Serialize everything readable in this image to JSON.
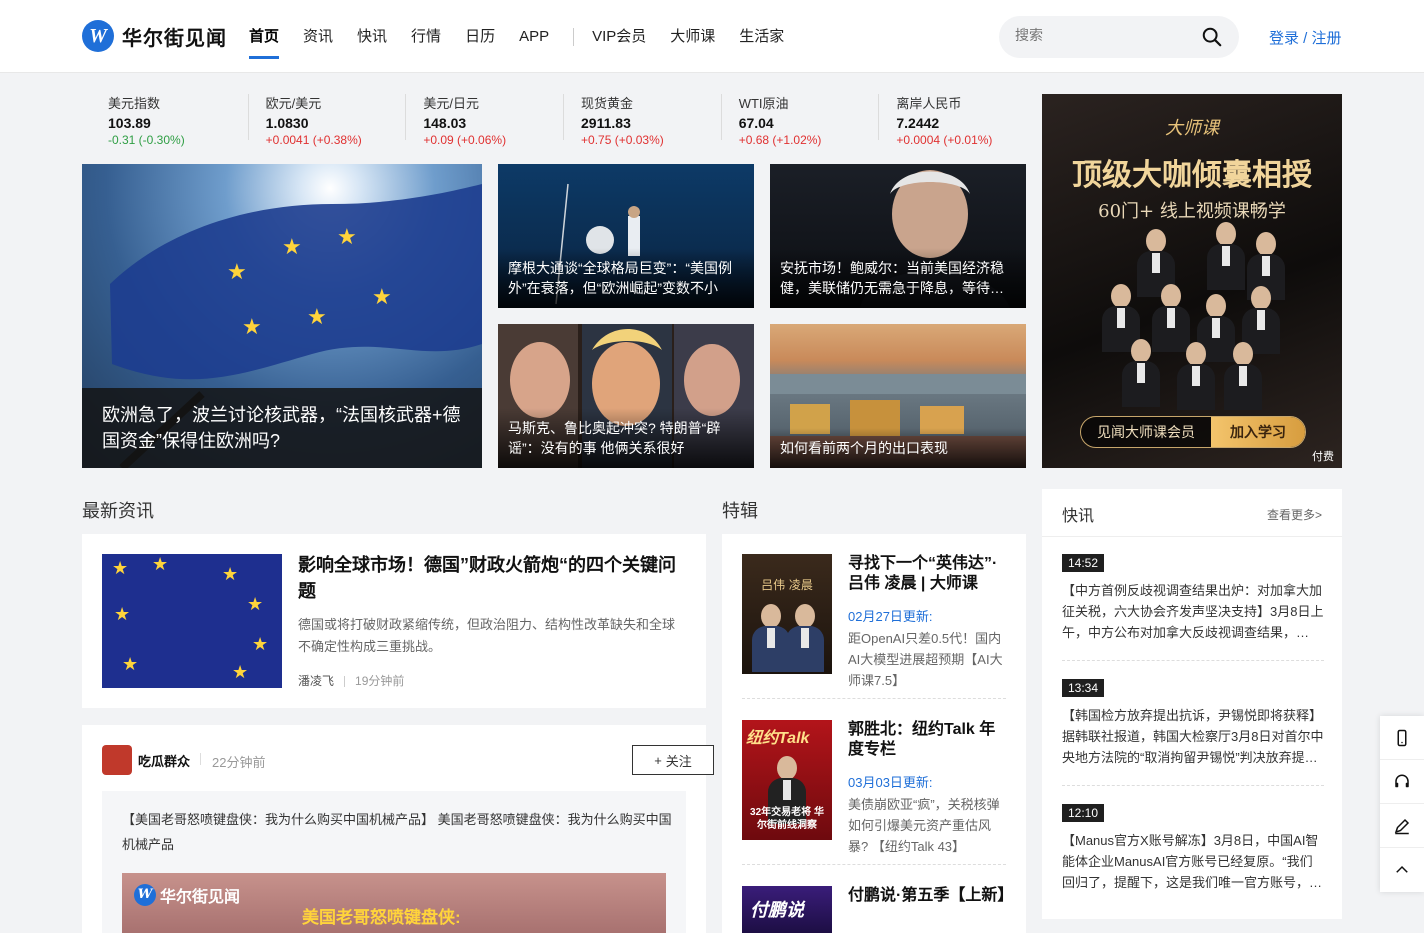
{
  "header": {
    "logo_text": "华尔街见闻",
    "nav": [
      {
        "label": "首页",
        "active": true
      },
      {
        "label": "资讯"
      },
      {
        "label": "快讯"
      },
      {
        "label": "行情"
      },
      {
        "label": "日历"
      },
      {
        "label": "APP"
      },
      {
        "label": "VIP会员"
      },
      {
        "label": "大师课"
      },
      {
        "label": "生活家"
      }
    ],
    "search_placeholder": "搜索",
    "login": "登录 / 注册"
  },
  "ticker": [
    {
      "name": "美元指数",
      "price": "103.89",
      "change": "-0.31 (-0.30%)",
      "dir": "down"
    },
    {
      "name": "欧元/美元",
      "price": "1.0830",
      "change": "+0.0041 (+0.38%)",
      "dir": "up"
    },
    {
      "name": "美元/日元",
      "price": "148.03",
      "change": "+0.09 (+0.06%)",
      "dir": "up"
    },
    {
      "name": "现货黄金",
      "price": "2911.83",
      "change": "+0.75 (+0.03%)",
      "dir": "up"
    },
    {
      "name": "WTI原油",
      "price": "67.04",
      "change": "+0.68 (+1.02%)",
      "dir": "up"
    },
    {
      "name": "离岸人民币",
      "price": "7.2442",
      "change": "+0.0004 (+0.01%)",
      "dir": "up"
    }
  ],
  "hero": {
    "main": "欧洲急了，波兰讨论核武器，“法国核武器+德国资金”保得住欧洲吗?",
    "tiles": [
      "摩根大通谈“全球格局巨变”：“美国例外”在衰落，但“欧洲崛起”变数不小",
      "安抚市场！鲍威尔：当前美国经济稳健，美联储仍无需急于降息，等待…",
      "马斯克、鲁比奥起冲突? 特朗普“辟谣”：没有的事 他俩关系很好",
      "如何看前两个月的出口表现"
    ]
  },
  "ad": {
    "brand": "大师课",
    "title": "顶级大咖倾囊相授",
    "subtitle": "60门+ 线上视频课畅学",
    "button_left": "见闻大师课会员",
    "button_right": "加入学习",
    "paid": "付费"
  },
  "latest": {
    "title": "最新资讯",
    "article": {
      "title": "影响全球市场！德国”财政火箭炮“的四个关键问题",
      "summary": "德国或将打破财政紧缩传统，但政治阻力、结构性改革缺失和全球不确定性构成三重挑战。",
      "author": "潘凌飞",
      "time": "19分钟前"
    },
    "post": {
      "user": "吃瓜群众",
      "time": "22分钟前",
      "follow": "关注",
      "text": "【美国老哥怒喷键盘侠：我为什么购买中国机械产品】 美国老哥怒喷键盘侠：我为什么购买中国机械产品",
      "video_logo": "华尔街见闻",
      "video_caption": "美国老哥怒喷键盘侠:"
    }
  },
  "special": {
    "title": "特辑",
    "items": [
      {
        "title": "寻找下一个“英伟达”· 吕伟 凌晨 | 大师课",
        "date": "02月27日更新:",
        "desc": "距OpenAI只差0.5代！国内AI大模型进展超预期【AI大师课7.5】",
        "cover_label": "吕伟 凌晨"
      },
      {
        "title": "郭胜北：纽约Talk 年度专栏",
        "date": "03月03日更新:",
        "desc": "美债崩欧亚“疯”，关税核弹如何引爆美元资产重估风暴? 【纽约Talk 43】",
        "cover_label": "纽约Talk",
        "cover_sub": "32年交易老将 华尔街前线洞察"
      },
      {
        "title": "付鹏说·第五季【上新】",
        "cover_label": "付鹏说"
      }
    ]
  },
  "flash": {
    "title": "快讯",
    "more": "查看更多>",
    "items": [
      {
        "time": "14:52",
        "text": "【中方首例反歧视调查结果出炉：对加拿大加征关税，六大协会齐发声坚决支持】3月8日上午，中方公布对加拿大反歧视调查结果，…"
      },
      {
        "time": "13:34",
        "text": "【韩国检方放弃提出抗诉，尹锡悦即将获释】据韩联社报道，韩国大检察厅3月8日对首尔中央地方法院的“取消拘留尹锡悦”判决放弃提…"
      },
      {
        "time": "12:10",
        "text": "【Manus官方X账号解冻】3月8日，中国AI智能体企业ManusAI官方账号已经复原。“我们回归了，提醒下，这是我们唯一官方账号，…"
      }
    ]
  },
  "colors": {
    "accent": "#1f6fd8",
    "up": "#e03131",
    "down": "#2f9e44"
  }
}
